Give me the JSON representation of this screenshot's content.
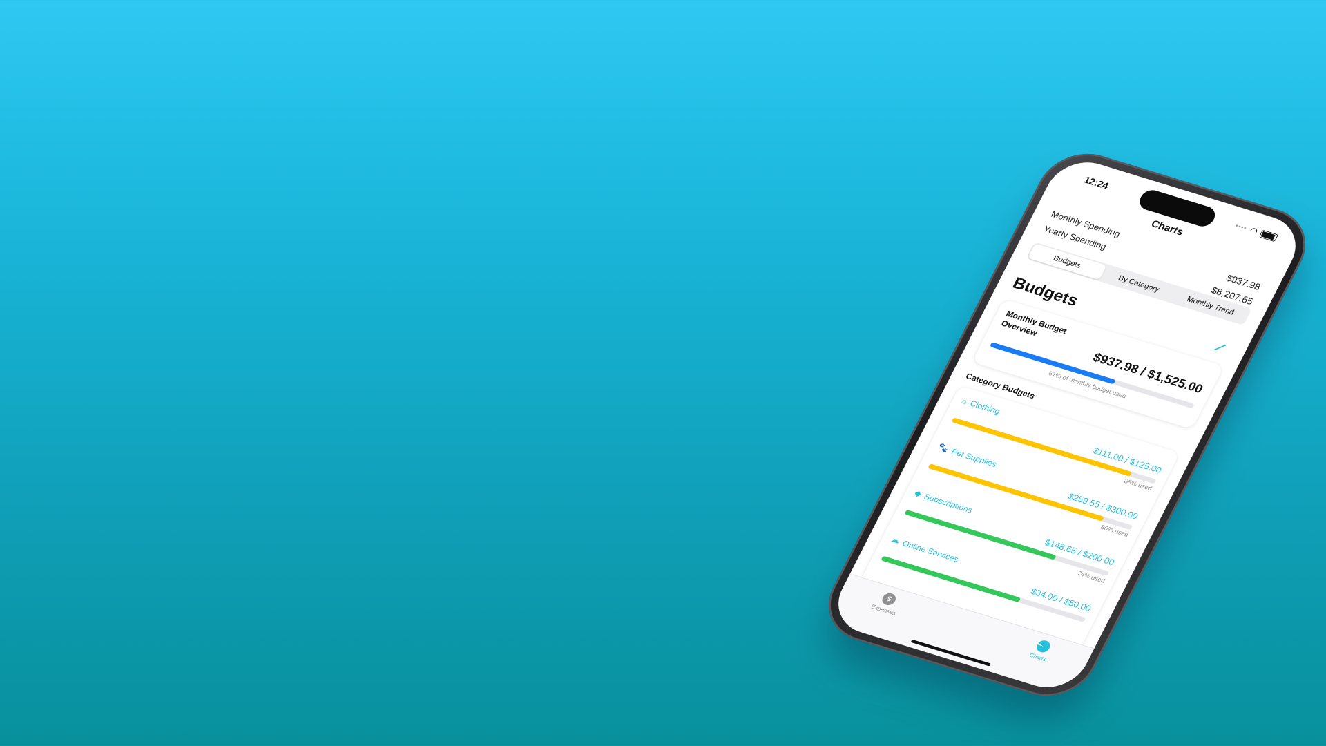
{
  "status": {
    "time": "12:24"
  },
  "nav": {
    "title": "Charts"
  },
  "summary": {
    "monthly_label": "Monthly Spending",
    "monthly_value": "$937.98",
    "yearly_label": "Yearly Spending",
    "yearly_value": "$8,207.65"
  },
  "segments": [
    "Budgets",
    "By Category",
    "Monthly Trend"
  ],
  "section_title": "Budgets",
  "overview": {
    "label": "Monthly Budget Overview",
    "amount": "$937.98 / $1,525.00",
    "note": "61% of monthly budget used",
    "fraction": 0.61,
    "color": "#1a7cf5"
  },
  "category_heading": "Category Budgets",
  "categories": [
    {
      "name": "Clothing",
      "icon": "hanger-icon",
      "amount": "$111.00 / $125.00",
      "used": "88% used",
      "fraction": 0.88,
      "color": "#ffc400"
    },
    {
      "name": "Pet Supplies",
      "icon": "paw-icon",
      "amount": "$259.55 / $300.00",
      "used": "86% used",
      "fraction": 0.86,
      "color": "#ffc400"
    },
    {
      "name": "Subscriptions",
      "icon": "tag-icon",
      "amount": "$148.65 / $200.00",
      "used": "74% used",
      "fraction": 0.74,
      "color": "#34c759"
    },
    {
      "name": "Online Services",
      "icon": "cloud-icon",
      "amount": "$34.00 / $50.00",
      "used": "",
      "fraction": 0.68,
      "color": "#34c759"
    }
  ],
  "tabs": {
    "expenses": "Expenses",
    "charts": "Charts"
  },
  "colors": {
    "accent": "#27c1dc"
  }
}
